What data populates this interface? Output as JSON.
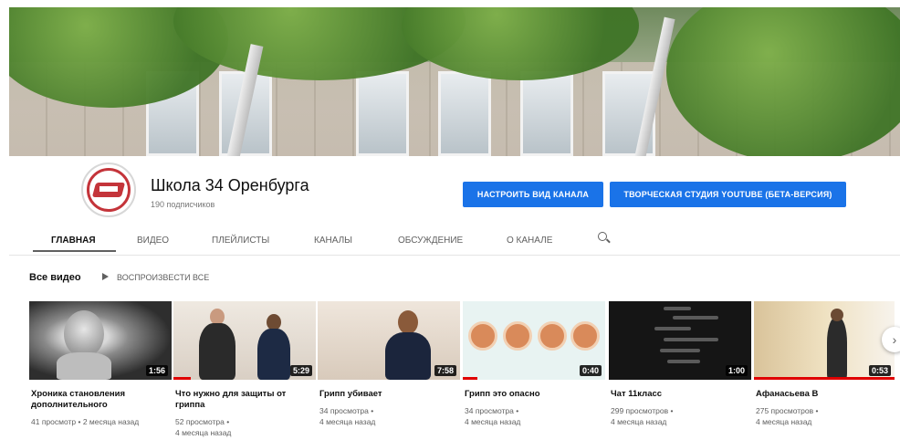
{
  "channel": {
    "name": "Школа 34 Оренбурга",
    "subscribers": "190 подписчиков",
    "customize_button": "НАСТРОИТЬ ВИД КАНАЛА",
    "studio_button": "ТВОРЧЕСКАЯ СТУДИЯ YOUTUBE (БЕТА-ВЕРСИЯ)"
  },
  "tabs": [
    {
      "label": "ГЛАВНАЯ",
      "active": true
    },
    {
      "label": "ВИДЕО",
      "active": false
    },
    {
      "label": "ПЛЕЙЛИСТЫ",
      "active": false
    },
    {
      "label": "КАНАЛЫ",
      "active": false
    },
    {
      "label": "ОБСУЖДЕНИЕ",
      "active": false
    },
    {
      "label": "О КАНАЛЕ",
      "active": false
    }
  ],
  "section": {
    "title": "Все видео",
    "play_all": "ВОСПРОИЗВЕСТИ ВСЕ"
  },
  "videos": [
    {
      "title": "Хроника становления дополнительного",
      "duration": "1:56",
      "meta_line1": "41 просмотр • 2 месяца назад",
      "meta_line2": "",
      "watched": 0
    },
    {
      "title": "Что нужно для защиты от гриппа",
      "duration": "5:29",
      "meta_line1": "52 просмотра •",
      "meta_line2": "4 месяца назад",
      "watched": 0.12
    },
    {
      "title": "Грипп убивает",
      "duration": "7:58",
      "meta_line1": "34 просмотра •",
      "meta_line2": "4 месяца назад",
      "watched": 0
    },
    {
      "title": "Грипп это опасно",
      "duration": "0:40",
      "meta_line1": "34 просмотра •",
      "meta_line2": "4 месяца назад",
      "watched": 0.1
    },
    {
      "title": "Чат 11класс",
      "duration": "1:00",
      "meta_line1": "299 просмотров •",
      "meta_line2": "4 месяца назад",
      "watched": 0
    },
    {
      "title": "Афанасьева В",
      "duration": "0:53",
      "meta_line1": "275 просмотров •",
      "meta_line2": "4 месяца назад",
      "watched": 1
    }
  ],
  "icons": {
    "search": "search-icon",
    "play": "play-icon",
    "next": "chevron-right-icon"
  },
  "colors": {
    "accent": "#1a73e8",
    "progress": "#e00000"
  }
}
